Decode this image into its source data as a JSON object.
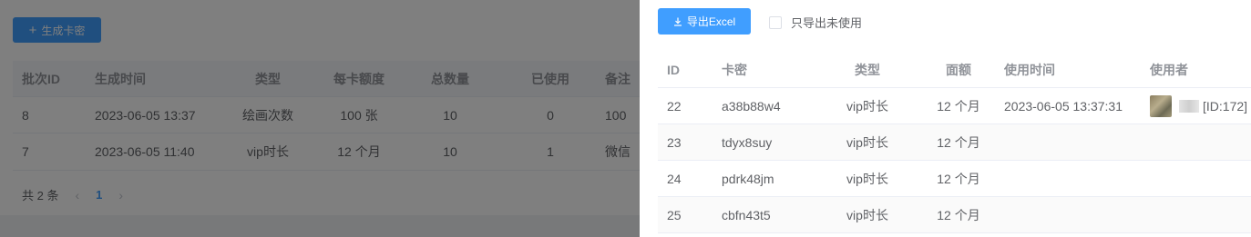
{
  "background": {
    "generate_button": {
      "label": "生成卡密",
      "icon": "plus-icon"
    },
    "table": {
      "headers": [
        "批次ID",
        "生成时间",
        "类型",
        "每卡额度",
        "总数量",
        "已使用",
        "备注"
      ],
      "rows": [
        [
          "8",
          "2023-06-05 13:37",
          "绘画次数",
          "100 张",
          "10",
          "0",
          "100"
        ],
        [
          "7",
          "2023-06-05 11:40",
          "vip时长",
          "12 个月",
          "10",
          "1",
          "微信"
        ]
      ]
    },
    "pagination": {
      "total": "共 2 条",
      "current_page": "1"
    }
  },
  "drawer": {
    "export_button": {
      "label": "导出Excel",
      "icon": "download-icon"
    },
    "unused_only_checkbox": {
      "label": "只导出未使用",
      "checked": false
    },
    "table": {
      "headers": [
        "ID",
        "卡密",
        "类型",
        "面额",
        "使用时间",
        "使用者"
      ],
      "rows": [
        {
          "id": "22",
          "code": "a38b88w4",
          "type": "vip时长",
          "value": "12 个月",
          "used_at": "2023-06-05 13:37:31",
          "user_id": "[ID:172]",
          "has_user": true
        },
        {
          "id": "23",
          "code": "tdyx8suy",
          "type": "vip时长",
          "value": "12 个月",
          "used_at": "",
          "user_id": "",
          "has_user": false
        },
        {
          "id": "24",
          "code": "pdrk48jm",
          "type": "vip时长",
          "value": "12 个月",
          "used_at": "",
          "user_id": "",
          "has_user": false
        },
        {
          "id": "25",
          "code": "cbfn43t5",
          "type": "vip时长",
          "value": "12 个月",
          "used_at": "",
          "user_id": "",
          "has_user": false
        }
      ]
    }
  },
  "colors": {
    "primary": "#409eff",
    "mask": "rgba(0,0,0,0.5)"
  }
}
